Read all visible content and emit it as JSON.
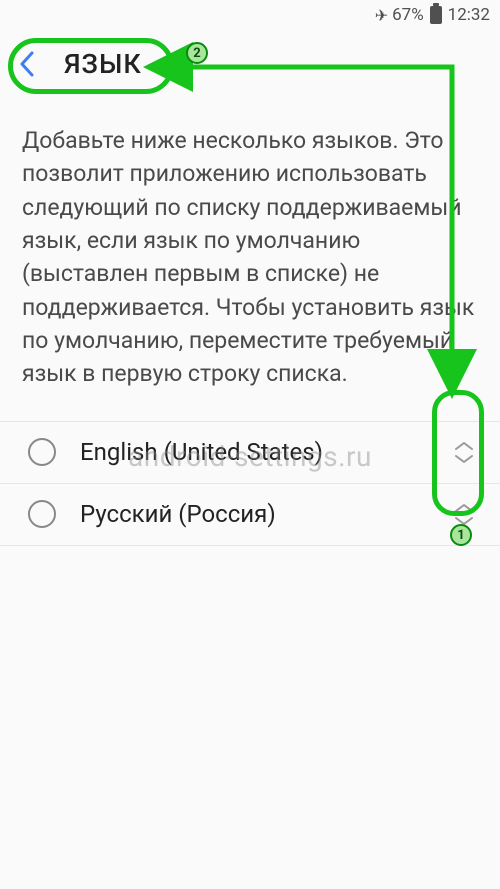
{
  "status": {
    "battery": "67%",
    "time": "12:32"
  },
  "header": {
    "title": "ЯЗЫК"
  },
  "description": "Добавьте ниже несколько языков. Это позволит приложению использовать следующий по списку поддерживаемый язык, если язык по умолчанию (выставлен первым в списке) не поддерживается. Чтобы установить язык по умолчанию, переместите требуемый язык в первую строку списка.",
  "languages": [
    {
      "label": "English (United States)",
      "selected": false
    },
    {
      "label": "Русский (Россия)",
      "selected": false
    }
  ],
  "annotations": {
    "marker1": "1",
    "marker2": "2"
  },
  "watermark": "android-settings.ru",
  "colors": {
    "accent_blue": "#3f7ef0",
    "annotation_green": "#17c41b"
  }
}
